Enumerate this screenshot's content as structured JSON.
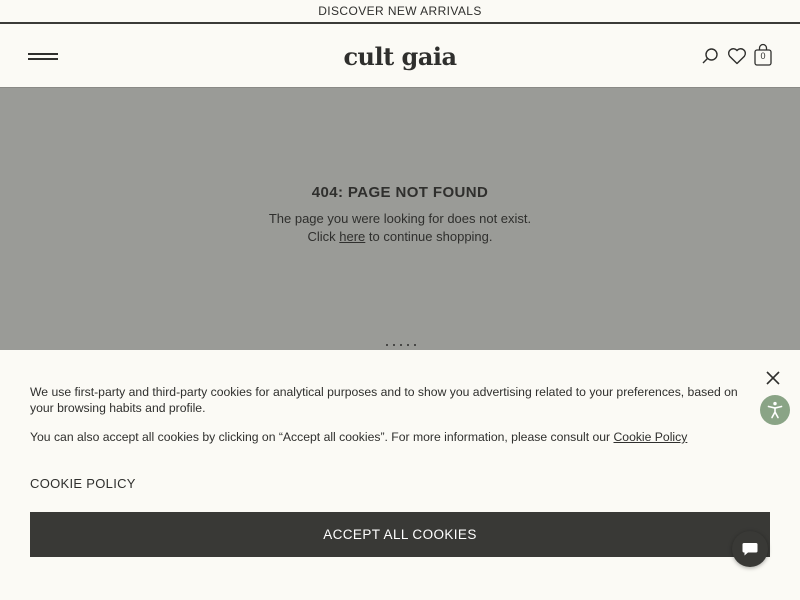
{
  "announcement": {
    "text": "DISCOVER NEW ARRIVALS"
  },
  "header": {
    "logo_text": "cult gaia",
    "icons": [
      "menu-icon",
      "search-icon",
      "heart-icon",
      "bag-icon"
    ],
    "bag_count": "0"
  },
  "error": {
    "title": "404: PAGE NOT FOUND",
    "line1": "The page you were looking for does not exist.",
    "line2_prefix": "Click ",
    "line2_link": "here",
    "line2_suffix": " to continue shopping."
  },
  "cookie_banner": {
    "text1": "We use first-party and third-party cookies for analytical purposes and to show you advertising related to your preferences, based on your browsing habits and profile.",
    "text2_prefix": "You can also accept all cookies by clicking on “Accept all cookies”. For more information, please consult our ",
    "text2_link": "Cookie Policy",
    "policy_link": "COOKIE POLICY",
    "accept_label": "ACCEPT ALL COOKIES"
  },
  "colors": {
    "overlay": "#9a9b97",
    "background": "#fbfaf5",
    "dark": "#393936",
    "accessibility": "#8aa486"
  }
}
